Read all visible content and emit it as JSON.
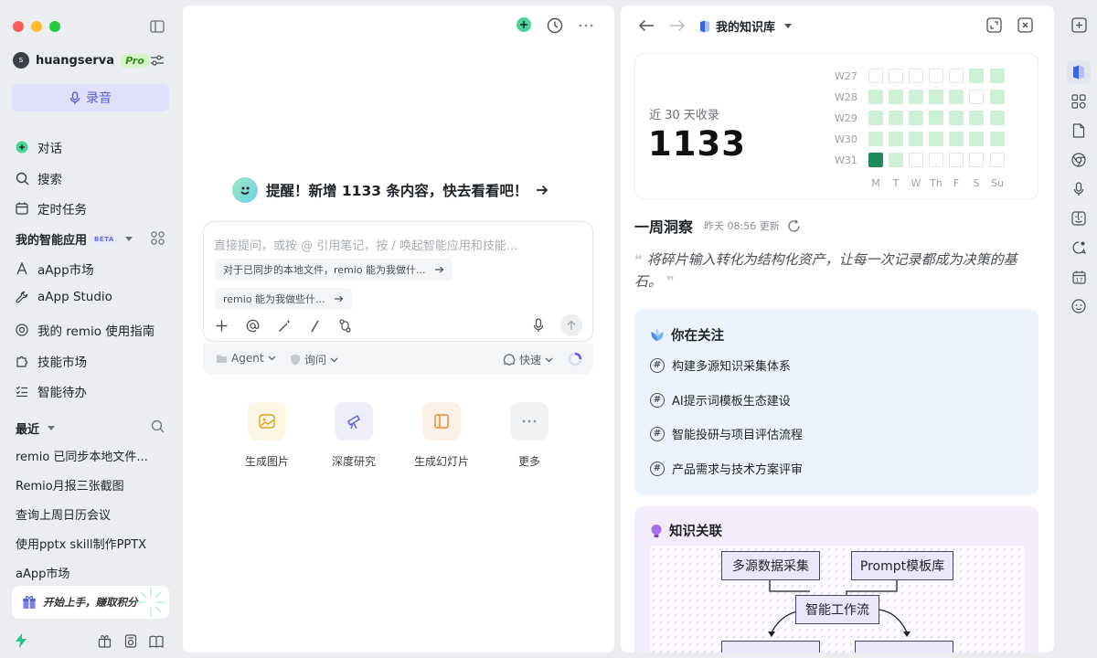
{
  "sidebar": {
    "user": {
      "avatar_initial": "s",
      "name": "huangserva",
      "plan": "Pro"
    },
    "record_label": "录音",
    "nav": [
      {
        "label": "对话",
        "icon": "chat-plus-icon"
      },
      {
        "label": "搜索",
        "icon": "search-icon"
      },
      {
        "label": "定时任务",
        "icon": "calendar-icon"
      }
    ],
    "apps_header": "我的智能应用",
    "apps_badge": "BETA",
    "apps": [
      {
        "label": "aApp市场",
        "icon": "market-icon"
      },
      {
        "label": "aApp Studio",
        "icon": "wrench-icon"
      },
      {
        "label": "我的 remio 使用指南",
        "icon": "guide-icon"
      },
      {
        "label": "技能市场",
        "icon": "puzzle-icon"
      },
      {
        "label": "智能待办",
        "icon": "checklist-icon"
      }
    ],
    "recent_header": "最近",
    "recent": [
      "remio 已同步本地文件...",
      "Remio月报三张截图",
      "查询上周日历会议",
      "使用pptx skill制作PPTX",
      "aApp市场"
    ],
    "promo": "开始上手，赚取积分"
  },
  "center": {
    "reminder": "提醒！新增 1133 条内容，快去看看吧！",
    "placeholder": "直接提问，或按 @ 引用笔记，按 / 唤起智能应用和技能...",
    "suggestions": [
      "对于已同步的本地文件，remio 能为我做什...",
      "remio 能为我做些什..."
    ],
    "modes": {
      "agent": "Agent",
      "ask": "询问",
      "speed": "快速"
    },
    "quick_actions": [
      {
        "label": "生成图片",
        "icon": "image-icon",
        "bg": "#fdf5e3",
        "color": "#e0a52a"
      },
      {
        "label": "深度研究",
        "icon": "telescope-icon",
        "bg": "#eeeefb",
        "color": "#6366d9"
      },
      {
        "label": "生成幻灯片",
        "icon": "slides-icon",
        "bg": "#fdf0e6",
        "color": "#e88b3e"
      },
      {
        "label": "更多",
        "icon": "more-icon",
        "bg": "#f1f2f4",
        "color": "#8a8e95"
      }
    ]
  },
  "right": {
    "title": "我的知识库",
    "stats": {
      "label": "近 30 天收录",
      "value": "1133",
      "weeks": [
        "W27",
        "W28",
        "W29",
        "W30",
        "W31"
      ],
      "days": [
        "M",
        "T",
        "W",
        "Th",
        "F",
        "S",
        "Su"
      ],
      "levels": [
        [
          0,
          0,
          0,
          0,
          0,
          1,
          1
        ],
        [
          1,
          1,
          1,
          1,
          1,
          0,
          1
        ],
        [
          1,
          1,
          1,
          1,
          1,
          1,
          1
        ],
        [
          1,
          1,
          1,
          1,
          1,
          1,
          1
        ],
        [
          2,
          1,
          0,
          0,
          0,
          0,
          0
        ]
      ]
    },
    "insight": {
      "title": "一周洞察",
      "meta": "昨天 08:56 更新",
      "quote": "将碎片输入转化为结构化资产，让每一次记录都成为决策的基石。"
    },
    "focus": {
      "title": "你在关注",
      "topics": [
        "构建多源知识采集体系",
        "AI提示词模板生态建设",
        "智能投研与项目评估流程",
        "产品需求与技术方案评审"
      ]
    },
    "knowledge": {
      "title": "知识关联",
      "nodes": [
        "多源数据采集",
        "Prompt模板库",
        "智能工作流"
      ]
    }
  },
  "colors": {
    "accent": "#5b5fd6",
    "green_dark": "#1e8a5a",
    "green_light": "#cfefd6",
    "empty_cell": "#ffffff"
  }
}
